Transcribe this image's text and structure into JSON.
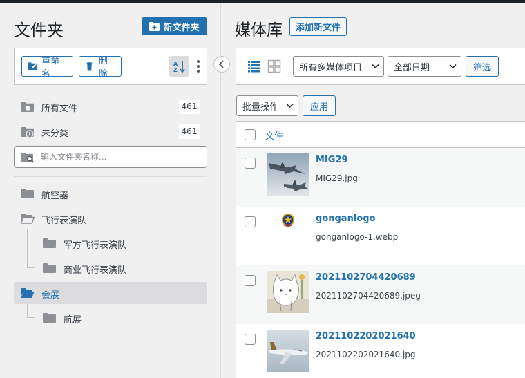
{
  "folders_panel": {
    "title": "文件夹",
    "new_folder_label": "新文件夹",
    "rename_label": "重命名",
    "delete_label": "删除",
    "system_items": [
      {
        "label": "所有文件",
        "count": "461"
      },
      {
        "label": "未分类",
        "count": "461"
      }
    ],
    "search_placeholder": "输入文件夹名称...",
    "tree": [
      {
        "label": "航空器",
        "level": 0,
        "open": false,
        "active": false
      },
      {
        "label": "飞行表演队",
        "level": 0,
        "open": true,
        "active": false
      },
      {
        "label": "军方飞行表演队",
        "level": 1,
        "open": false,
        "active": false
      },
      {
        "label": "商业飞行表演队",
        "level": 1,
        "open": false,
        "active": false
      },
      {
        "label": "会展",
        "level": 0,
        "open": true,
        "active": true
      },
      {
        "label": "航展",
        "level": 1,
        "open": false,
        "active": false
      }
    ]
  },
  "media": {
    "title": "媒体库",
    "add_file_label": "添加新文件",
    "type_filter": "所有多媒体项目",
    "date_filter": "全部日期",
    "filter_label": "筛选",
    "bulk_label": "批量操作",
    "apply_label": "应用",
    "column_file": "文件",
    "rows": [
      {
        "title": "MIG29",
        "filename": "MIG29.jpg",
        "thumb": "jets"
      },
      {
        "title": "gonganlogo",
        "filename": "gonganlogo-1.webp",
        "thumb": "emblem"
      },
      {
        "title": "2021102704420689",
        "filename": "2021102704420689.jpeg",
        "thumb": "cat-sketch"
      },
      {
        "title": "2021102202021640",
        "filename": "2021102202021640.jpg",
        "thumb": "airliner"
      }
    ]
  },
  "colors": {
    "accent": "#2271b1",
    "background": "#f0f0f1",
    "border": "#c3c4c7",
    "topbar": "#1d2327"
  }
}
